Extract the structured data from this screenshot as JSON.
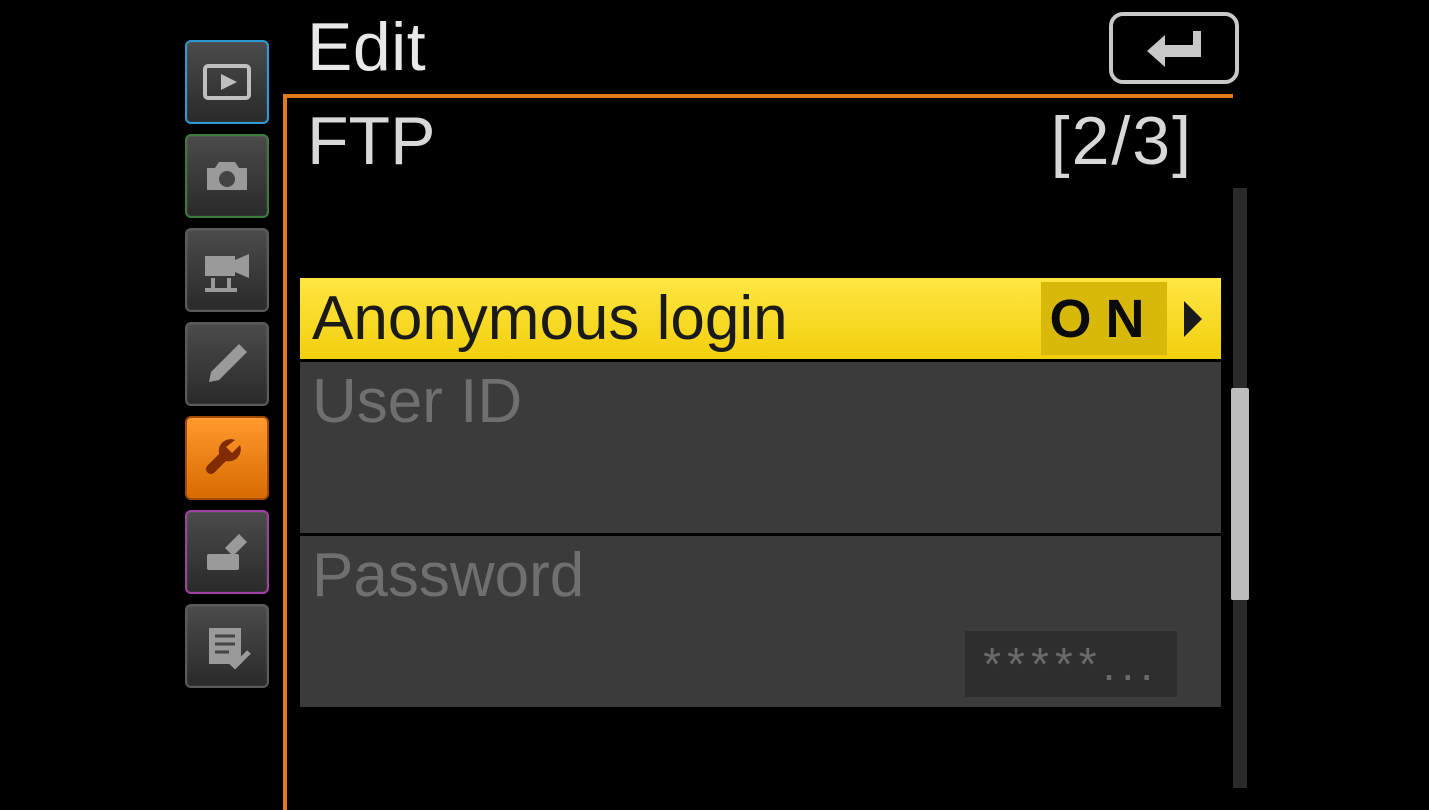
{
  "header": {
    "title": "Edit"
  },
  "section": {
    "title": "FTP",
    "page_indicator": "[2/3]"
  },
  "rows": {
    "anonymous": {
      "label": "Anonymous login",
      "value": "ON"
    },
    "userid": {
      "label": "User ID",
      "value": ""
    },
    "password": {
      "label": "Password",
      "value": "*****..."
    }
  },
  "sidebar": {
    "tabs": [
      {
        "name": "playback"
      },
      {
        "name": "photo"
      },
      {
        "name": "video"
      },
      {
        "name": "pencil"
      },
      {
        "name": "setup"
      },
      {
        "name": "retouch"
      },
      {
        "name": "mymenu"
      }
    ]
  }
}
